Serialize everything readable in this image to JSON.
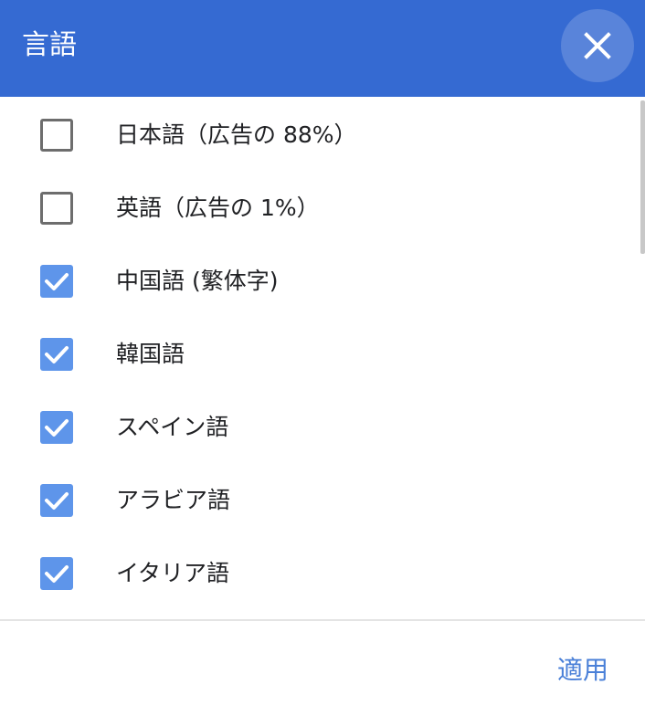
{
  "header": {
    "title": "言語",
    "close_icon": "close-icon",
    "background": "#356ad2"
  },
  "languages": [
    {
      "label": "日本語（広告の 88%）",
      "checked": false
    },
    {
      "label": "英語（広告の 1%）",
      "checked": false
    },
    {
      "label": "中国語 (繁体字)",
      "checked": true
    },
    {
      "label": "韓国語",
      "checked": true
    },
    {
      "label": "スペイン語",
      "checked": true
    },
    {
      "label": "アラビア語",
      "checked": true
    },
    {
      "label": "イタリア語",
      "checked": true
    }
  ],
  "footer": {
    "apply_label": "適用"
  },
  "colors": {
    "checkbox_checked": "#5e95ea",
    "checkbox_unchecked_border": "#6d6d6d",
    "apply_text": "#4a80d8"
  }
}
